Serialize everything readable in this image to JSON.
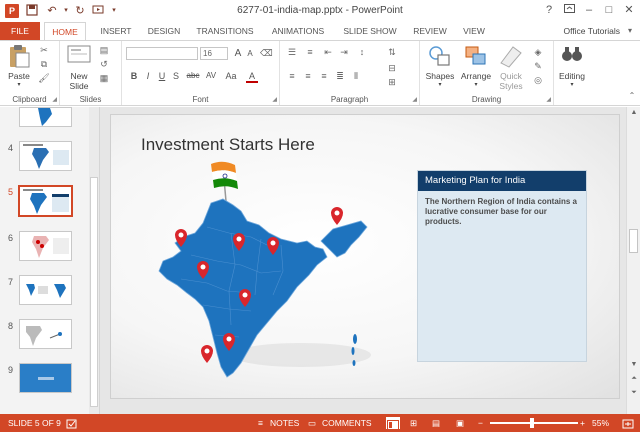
{
  "titlebar": {
    "app_icon_letter": "P",
    "title": "6277-01-india-map.pptx - PowerPoint",
    "help": "?",
    "minimize": "–",
    "maximize": "□",
    "close": "✕"
  },
  "tabs": {
    "items": [
      "FILE",
      "HOME",
      "INSERT",
      "DESIGN",
      "TRANSITIONS",
      "ANIMATIONS",
      "SLIDE SHOW",
      "REVIEW",
      "VIEW"
    ],
    "active": "HOME",
    "user": "Office Tutorials"
  },
  "ribbon": {
    "groups": {
      "clipboard": "Clipboard",
      "slides": "Slides",
      "font": "Font",
      "paragraph": "Paragraph",
      "drawing": "Drawing"
    },
    "paste_label": "Paste",
    "new_slide_label_1": "New",
    "new_slide_label_2": "Slide",
    "font_size": "16",
    "shapes_label": "Shapes",
    "arrange_label": "Arrange",
    "quick_styles_label_1": "Quick",
    "quick_styles_label_2": "Styles",
    "editing_label": "Editing",
    "format_buttons": [
      "B",
      "I",
      "U",
      "S",
      "abc",
      "AV",
      "Aa",
      "A"
    ],
    "font_size_buttons": [
      "A",
      "A"
    ]
  },
  "thumbnails": [
    {
      "number": "4",
      "selected": false
    },
    {
      "number": "5",
      "selected": true
    },
    {
      "number": "6",
      "selected": false
    },
    {
      "number": "7",
      "selected": false
    },
    {
      "number": "8",
      "selected": false
    },
    {
      "number": "9",
      "selected": false
    }
  ],
  "slide": {
    "title": "Investment Starts Here",
    "panel_heading": "Marketing Plan for India",
    "panel_body": "The Northern Region of India contains a lucrative consumer base for our products."
  },
  "statusbar": {
    "slide_info": "SLIDE 5 OF 9",
    "notes": "NOTES",
    "comments": "COMMENTS",
    "zoom": "55%"
  },
  "colors": {
    "accent": "#d24726",
    "panel_header": "#123e6b",
    "panel_bg": "#dde9f2",
    "map_blue": "#1e73be",
    "pin_red": "#d9262c"
  }
}
